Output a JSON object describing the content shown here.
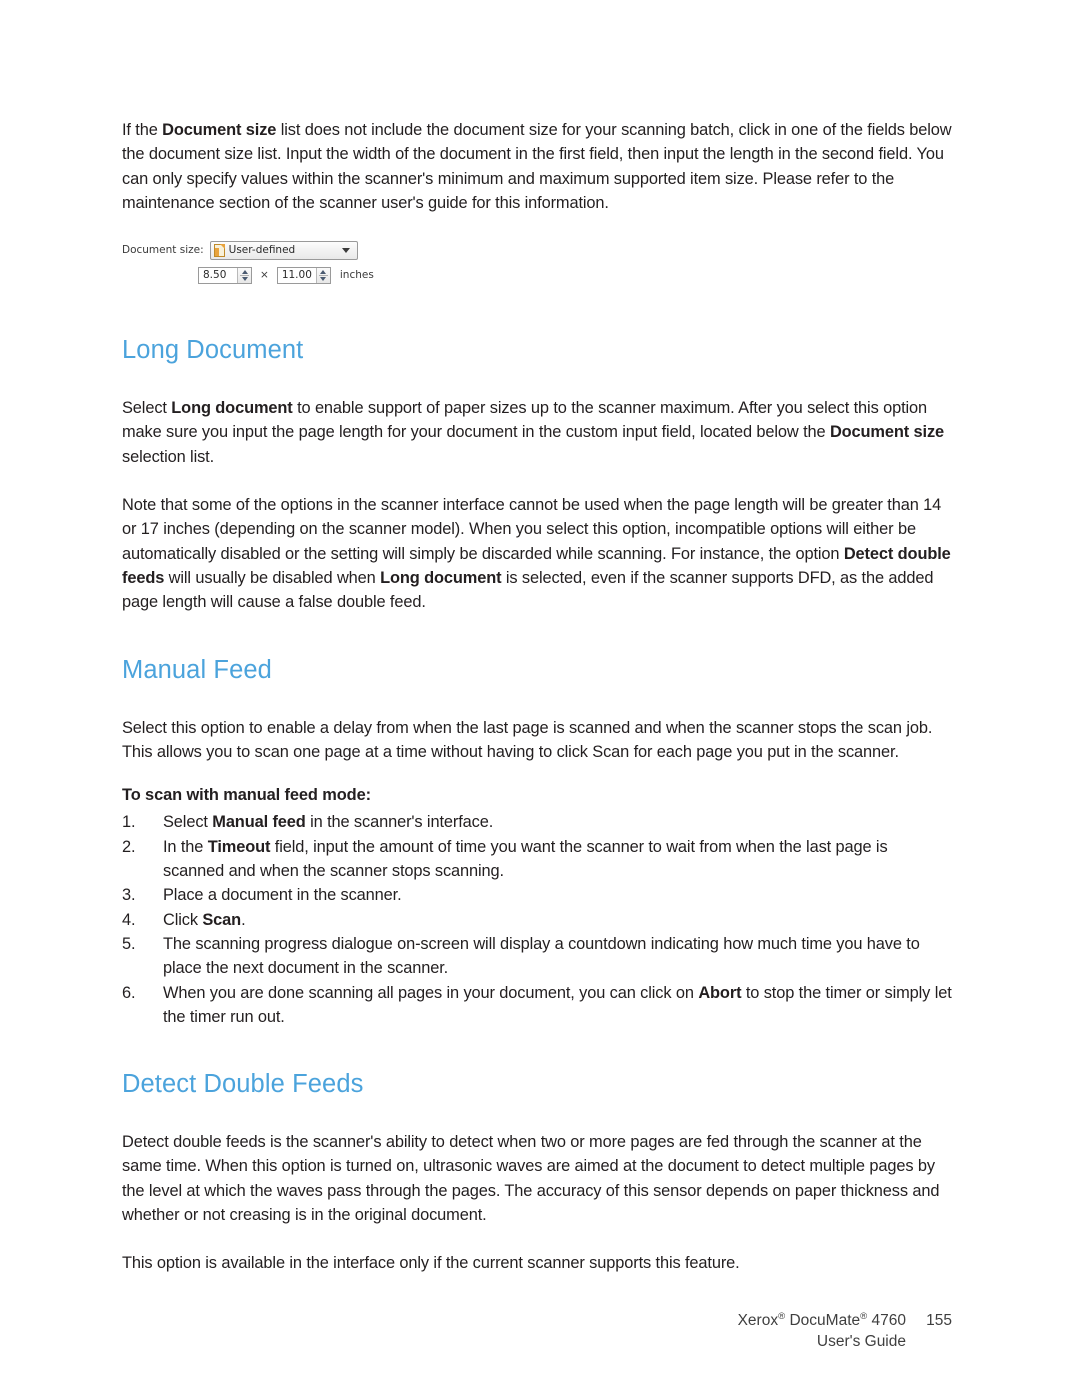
{
  "document": {
    "heading_color": "#4ba3dc",
    "body_color": "#231f20"
  },
  "intro_paragraph": {
    "p1_a": "If the ",
    "p1_b": "Document size",
    "p1_c": " list does not include the document size for your scanning batch, click in one of the fields below the document size list. Input the width of the document in the first field, then input the length in the second field. You can only specify values within the scanner's minimum and maximum supported item size. Please refer to the maintenance section of the scanner user's guide for this information."
  },
  "widget": {
    "label": "Document size:",
    "combo_value": "User-defined",
    "combo_icon": "page-icon",
    "arrow_icon": "chevron-down-icon",
    "width_value": "8.50",
    "multiply_symbol": "×",
    "height_value": "11.00",
    "unit": "inches"
  },
  "sections": [
    {
      "heading": "Long Document",
      "paragraphs": [
        {
          "parts": [
            {
              "t": "Select ",
              "b": false
            },
            {
              "t": "Long document",
              "b": true
            },
            {
              "t": " to enable support of paper sizes up to the scanner maximum. After you select this option make sure you input the page length for your document in the custom input field, located below the ",
              "b": false
            },
            {
              "t": "Document size",
              "b": true
            },
            {
              "t": " selection list.",
              "b": false
            }
          ]
        },
        {
          "parts": [
            {
              "t": "Note that some of the options in the scanner interface cannot be used when the page length will be greater than 14 or 17 inches (depending on the scanner model). When you select this option, incompatible options will either be automatically disabled or the setting will simply be discarded while scanning. For instance, the option ",
              "b": false
            },
            {
              "t": "Detect double feeds",
              "b": true
            },
            {
              "t": " will usually be disabled when ",
              "b": false
            },
            {
              "t": "Long document",
              "b": true
            },
            {
              "t": " is selected, even if the scanner supports DFD, as the added page length will cause a false double feed.",
              "b": false
            }
          ]
        }
      ]
    },
    {
      "heading": "Manual Feed",
      "paragraphs": [
        {
          "parts": [
            {
              "t": "Select this option to enable a delay from when the last page is scanned and when the scanner stops the scan job. This allows you to scan one page at a time without having to click Scan for each page you put in the scanner.",
              "b": false
            }
          ]
        }
      ]
    },
    {
      "heading": "Detect Double Feeds",
      "paragraphs": [
        {
          "parts": [
            {
              "t": "Detect double feeds is the scanner's ability to detect when two or more pages are fed through the scanner at the same time. When this option is turned on, ultrasonic waves are aimed at the document to detect multiple pages by the level at which the waves pass through the pages. The accuracy of this sensor depends on paper thickness and whether or not creasing is in the original document.",
              "b": false
            }
          ]
        },
        {
          "parts": [
            {
              "t": "This option is available in the interface only if the current scanner supports this feature.",
              "b": false
            }
          ]
        }
      ]
    }
  ],
  "procedure": {
    "title": "To scan with manual feed mode:",
    "steps": [
      {
        "num": "1.",
        "parts": [
          {
            "t": "Select ",
            "b": false
          },
          {
            "t": "Manual feed",
            "b": true
          },
          {
            "t": " in the scanner's interface.",
            "b": false
          }
        ]
      },
      {
        "num": "2.",
        "parts": [
          {
            "t": "In the ",
            "b": false
          },
          {
            "t": "Timeout",
            "b": true
          },
          {
            "t": " field, input the amount of time you want the scanner to wait from when the last page is scanned and when the scanner stops scanning.",
            "b": false
          }
        ]
      },
      {
        "num": "3.",
        "parts": [
          {
            "t": "Place a document in the scanner.",
            "b": false
          }
        ]
      },
      {
        "num": "4.",
        "parts": [
          {
            "t": "Click ",
            "b": false
          },
          {
            "t": "Scan",
            "b": true
          },
          {
            "t": ".",
            "b": false
          }
        ]
      },
      {
        "num": "5.",
        "parts": [
          {
            "t": "The scanning progress dialogue on-screen will display a countdown indicating how much time you have to place the next document in the scanner.",
            "b": false
          }
        ]
      },
      {
        "num": "6.",
        "parts": [
          {
            "t": "When you are done scanning all pages in your document, you can click on ",
            "b": false
          },
          {
            "t": "Abort",
            "b": true
          },
          {
            "t": " to stop the timer or simply let the timer run out.",
            "b": false
          }
        ]
      }
    ]
  },
  "footer": {
    "product_pre": "Xerox",
    "product_mid": " DocuMate",
    "product_post": " 4760",
    "registered_mark": "®",
    "page_number": "155",
    "guide_label": "User's Guide"
  }
}
